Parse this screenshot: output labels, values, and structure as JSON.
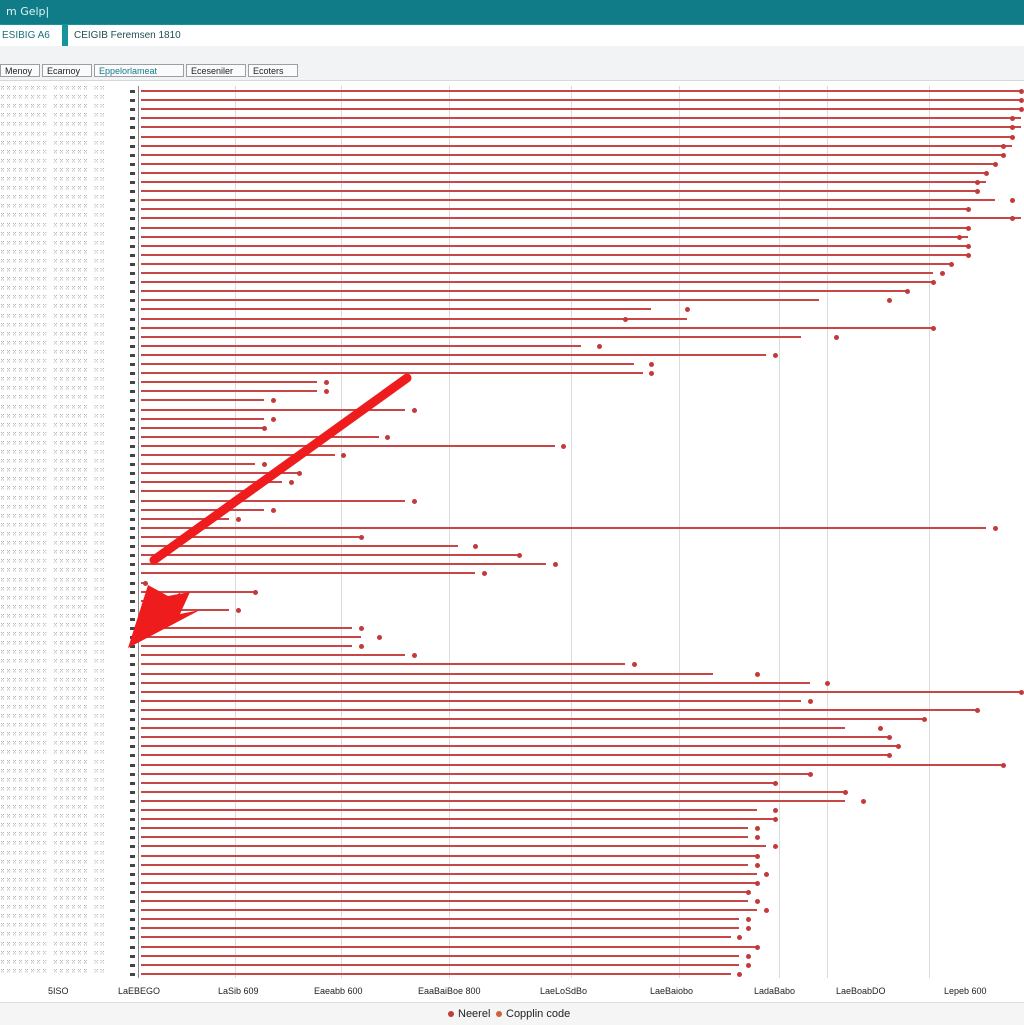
{
  "window": {
    "title": "m Gelp|"
  },
  "tabs": [
    {
      "label": "ESIBIG A6"
    },
    {
      "label": "CEIGIB Feremsen 1810"
    }
  ],
  "toolbar": {
    "buttons": [
      {
        "label": "Menoy"
      },
      {
        "label": "Ecarnoy"
      },
      {
        "label": "Eppelorlameat"
      },
      {
        "label": "Eceseniler"
      },
      {
        "label": "Ecoters"
      }
    ]
  },
  "chart_data": {
    "type": "scatter",
    "title": "",
    "xlabel": "",
    "ylabel": "",
    "x_tick_labels": [
      "5ISO",
      "LaEBEGO",
      "LaSib 609",
      "Eaeabb 600",
      "EaaBaiBoe 800",
      "LaeLoSdBo",
      "LaeBaiobo",
      "LadaBabo",
      "LaeBoabDO",
      "Lepeb 600"
    ],
    "y_count": 98,
    "bars": [
      {
        "end": 100,
        "dot": 100
      },
      {
        "end": 100,
        "dot": 100
      },
      {
        "end": 100,
        "dot": 100
      },
      {
        "end": 100,
        "dot": 99
      },
      {
        "end": 100,
        "dot": 99
      },
      {
        "end": 99,
        "dot": 99
      },
      {
        "end": 99,
        "dot": 98
      },
      {
        "end": 98,
        "dot": 98
      },
      {
        "end": 97,
        "dot": 97
      },
      {
        "end": 96,
        "dot": 96
      },
      {
        "end": 96,
        "dot": 95
      },
      {
        "end": 95,
        "dot": 95
      },
      {
        "end": 97,
        "dot": 99
      },
      {
        "end": 94,
        "dot": 94
      },
      {
        "end": 100,
        "dot": 99
      },
      {
        "end": 94,
        "dot": 94
      },
      {
        "end": 94,
        "dot": 93
      },
      {
        "end": 94,
        "dot": 94
      },
      {
        "end": 94,
        "dot": 94
      },
      {
        "end": 92,
        "dot": 92
      },
      {
        "end": 90,
        "dot": 91
      },
      {
        "end": 90,
        "dot": 90
      },
      {
        "end": 87,
        "dot": 87
      },
      {
        "end": 77,
        "dot": 85
      },
      {
        "end": 58,
        "dot": 62
      },
      {
        "end": 62,
        "dot": 55
      },
      {
        "end": 90,
        "dot": 90
      },
      {
        "end": 75,
        "dot": 79
      },
      {
        "end": 50,
        "dot": 52
      },
      {
        "end": 71,
        "dot": 72
      },
      {
        "end": 56,
        "dot": 58
      },
      {
        "end": 57,
        "dot": 58
      },
      {
        "end": 20,
        "dot": 21
      },
      {
        "end": 20,
        "dot": 21
      },
      {
        "end": 14,
        "dot": 15
      },
      {
        "end": 30,
        "dot": 31
      },
      {
        "end": 14,
        "dot": 15
      },
      {
        "end": 14,
        "dot": 14
      },
      {
        "end": 27,
        "dot": 28
      },
      {
        "end": 47,
        "dot": 48
      },
      {
        "end": 22,
        "dot": 23
      },
      {
        "end": 13,
        "dot": 14
      },
      {
        "end": 18,
        "dot": 18
      },
      {
        "end": 16,
        "dot": 17
      },
      {
        "end": 12,
        "dot": 12
      },
      {
        "end": 30,
        "dot": 31
      },
      {
        "end": 14,
        "dot": 15
      },
      {
        "end": 10,
        "dot": 11
      },
      {
        "end": 96,
        "dot": 97
      },
      {
        "end": 25,
        "dot": 25
      },
      {
        "end": 36,
        "dot": 38
      },
      {
        "end": 43,
        "dot": 43
      },
      {
        "end": 46,
        "dot": 47
      },
      {
        "end": 38,
        "dot": 39
      },
      {
        "end": 0.5,
        "dot": 0.5
      },
      {
        "end": 13,
        "dot": 13
      },
      {
        "end": 1,
        "dot": 1
      },
      {
        "end": 10,
        "dot": 11
      },
      {
        "end": 1,
        "dot": 1
      },
      {
        "end": 24,
        "dot": 25
      },
      {
        "end": 25,
        "dot": 27
      },
      {
        "end": 24,
        "dot": 25
      },
      {
        "end": 30,
        "dot": 31
      },
      {
        "end": 55,
        "dot": 56
      },
      {
        "end": 65,
        "dot": 70
      },
      {
        "end": 76,
        "dot": 78
      },
      {
        "end": 100,
        "dot": 100
      },
      {
        "end": 75,
        "dot": 76
      },
      {
        "end": 95,
        "dot": 95
      },
      {
        "end": 89,
        "dot": 89
      },
      {
        "end": 80,
        "dot": 84
      },
      {
        "end": 85,
        "dot": 85
      },
      {
        "end": 86,
        "dot": 86
      },
      {
        "end": 85,
        "dot": 85
      },
      {
        "end": 98,
        "dot": 98
      },
      {
        "end": 76,
        "dot": 76
      },
      {
        "end": 72,
        "dot": 72
      },
      {
        "end": 80,
        "dot": 80
      },
      {
        "end": 80,
        "dot": 82
      },
      {
        "end": 70,
        "dot": 72
      },
      {
        "end": 72,
        "dot": 72
      },
      {
        "end": 69,
        "dot": 70
      },
      {
        "end": 69,
        "dot": 70
      },
      {
        "end": 71,
        "dot": 72
      },
      {
        "end": 70,
        "dot": 70
      },
      {
        "end": 69,
        "dot": 70
      },
      {
        "end": 70,
        "dot": 71
      },
      {
        "end": 70,
        "dot": 70
      },
      {
        "end": 69,
        "dot": 69
      },
      {
        "end": 69,
        "dot": 70
      },
      {
        "end": 70,
        "dot": 71
      },
      {
        "end": 68,
        "dot": 69
      },
      {
        "end": 68,
        "dot": 69
      },
      {
        "end": 67,
        "dot": 68
      },
      {
        "end": 70,
        "dot": 70
      },
      {
        "end": 68,
        "dot": 69
      },
      {
        "end": 68,
        "dot": 69
      },
      {
        "end": 67,
        "dot": 68
      }
    ],
    "legend": [
      {
        "label": "Neerel",
        "color": "#c43a3a"
      },
      {
        "label": "Copplin code",
        "color": "#d2603a"
      }
    ],
    "grid": true
  },
  "colors": {
    "titlebar": "#0f7c88",
    "tabbar": "#17939c",
    "bar": "#c94646",
    "arrow": "#ee1c1c"
  }
}
